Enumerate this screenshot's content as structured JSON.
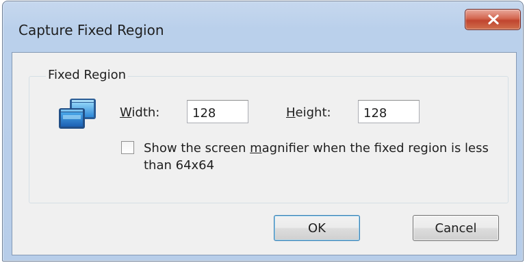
{
  "window": {
    "title": "Capture Fixed Region",
    "close_icon": "close-icon",
    "close_color": "#c7503a"
  },
  "group": {
    "label": "Fixed Region",
    "icon": "windows-icon"
  },
  "fields": {
    "width_label_accel": "W",
    "width_label_rest": "idth:",
    "width_value": "128",
    "height_label_accel": "H",
    "height_label_rest": "eight:",
    "height_value": "128"
  },
  "magnifier": {
    "checked": false,
    "label_pre": "Show the screen ",
    "label_accel": "m",
    "label_post": "agnifier when the fixed region is less than 64x64"
  },
  "buttons": {
    "ok": "OK",
    "cancel": "Cancel"
  }
}
